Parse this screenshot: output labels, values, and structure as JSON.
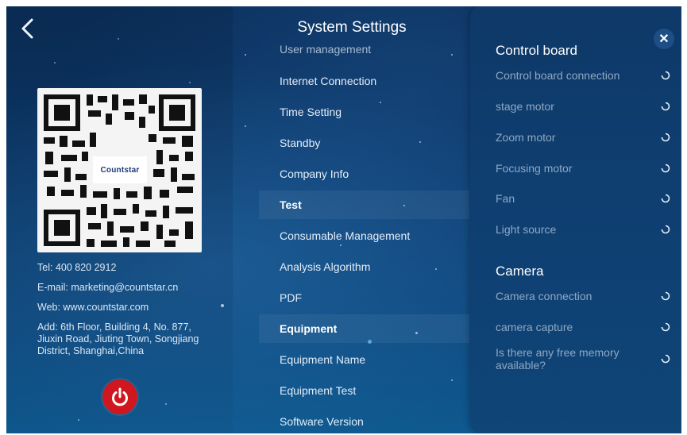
{
  "app": {
    "title": "System Settings"
  },
  "contact": {
    "qr_logo": "Countstar",
    "tel": "Tel: 400 820 2912",
    "email": "E-mail: marketing@countstar.cn",
    "web": "Web: www.countstar.com",
    "address": "Add: 6th Floor, Building 4, No. 877, Jiuxin Road, Jiuting Town, Songjiang District, Shanghai,China"
  },
  "menu": {
    "cut_item": "User management",
    "items": [
      {
        "label": "Internet Connection"
      },
      {
        "label": "Time Setting"
      },
      {
        "label": "Standby"
      },
      {
        "label": "Company Info"
      },
      {
        "label": "Test"
      },
      {
        "label": "Consumable Management"
      },
      {
        "label": "Analysis Algorithm"
      },
      {
        "label": "PDF"
      },
      {
        "label": "Equipment"
      },
      {
        "label": "Equipment Name"
      },
      {
        "label": "Equipment Test"
      },
      {
        "label": "Software Version"
      }
    ]
  },
  "panel": {
    "close_icon": "close-icon",
    "control_board": {
      "title": "Control board",
      "checks": [
        {
          "label": "Control board connection"
        },
        {
          "label": "stage motor"
        },
        {
          "label": "Zoom motor"
        },
        {
          "label": "Focusing motor"
        },
        {
          "label": "Fan"
        },
        {
          "label": "Light source"
        }
      ]
    },
    "camera": {
      "title": "Camera",
      "checks": [
        {
          "label": "Camera connection"
        },
        {
          "label": "camera capture"
        },
        {
          "label": "Is there any free memory available?"
        }
      ]
    }
  },
  "colors": {
    "power_button": "#d0161e",
    "panel_bg": "#0f3f72",
    "muted_text": "#8fa8c4"
  }
}
